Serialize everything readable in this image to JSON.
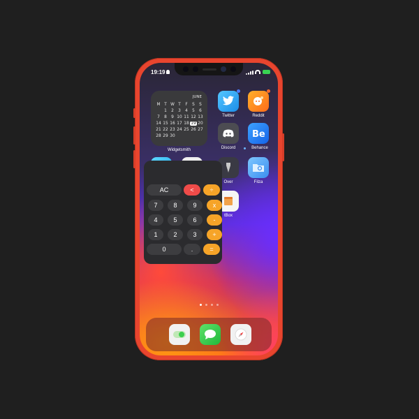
{
  "status_bar": {
    "time": "19:19"
  },
  "widget": {
    "month": "JUNE",
    "weekdays": [
      "M",
      "T",
      "W",
      "T",
      "F",
      "S",
      "S"
    ],
    "days": [
      "",
      "1",
      "2",
      "3",
      "4",
      "5",
      "6",
      "7",
      "8",
      "9",
      "10",
      "11",
      "12",
      "13",
      "14",
      "15",
      "16",
      "17",
      "18",
      "19",
      "20",
      "21",
      "22",
      "23",
      "24",
      "25",
      "26",
      "27",
      "28",
      "29",
      "30",
      "",
      "",
      "",
      "",
      "",
      ""
    ],
    "today": "19",
    "label": "Widgetsmith"
  },
  "apps": {
    "twitter": "Twitter",
    "reddit": "Reddit",
    "discord": "Discord",
    "behance": "Behance",
    "filza": "Filza",
    "over": "Over",
    "tbox": "tBox"
  },
  "calculator": {
    "rows": [
      [
        {
          "label": "AC",
          "kind": "num"
        },
        {
          "label": "<",
          "kind": "back"
        },
        {
          "label": "÷",
          "kind": "op"
        }
      ],
      [
        {
          "label": "7",
          "kind": "num"
        },
        {
          "label": "8",
          "kind": "num"
        },
        {
          "label": "9",
          "kind": "num"
        },
        {
          "label": "x",
          "kind": "op"
        }
      ],
      [
        {
          "label": "4",
          "kind": "num"
        },
        {
          "label": "5",
          "kind": "num"
        },
        {
          "label": "6",
          "kind": "num"
        },
        {
          "label": "-",
          "kind": "op"
        }
      ],
      [
        {
          "label": "1",
          "kind": "num"
        },
        {
          "label": "2",
          "kind": "num"
        },
        {
          "label": "3",
          "kind": "num"
        },
        {
          "label": "+",
          "kind": "op"
        }
      ],
      [
        {
          "label": "0",
          "kind": "num"
        },
        {
          "label": ".",
          "kind": "num"
        },
        {
          "label": "=",
          "kind": "op"
        }
      ]
    ]
  },
  "colors": {
    "accent": "#f6a428",
    "frame": "#e8452e",
    "backspace": "#ef4b49"
  },
  "dock": {
    "icons": [
      "toggle-icon",
      "messages-icon",
      "compass-icon"
    ]
  }
}
